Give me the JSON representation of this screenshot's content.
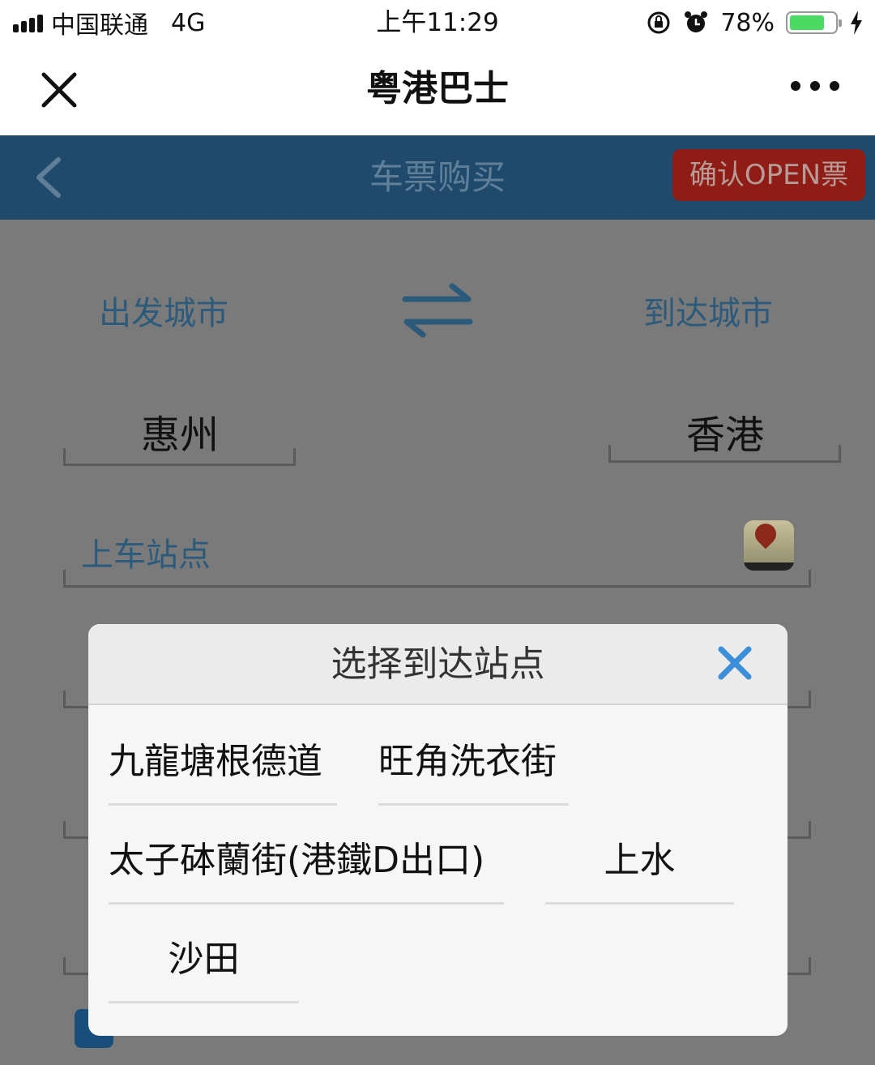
{
  "status_bar": {
    "carrier": "中国联通",
    "network": "4G",
    "time": "上午11:29",
    "battery": "78%",
    "battery_level": 0.78
  },
  "nav": {
    "title": "粤港巴士"
  },
  "page": {
    "title": "车票购买",
    "open_ticket_button": "确认OPEN票",
    "departure_city_label": "出发城市",
    "arrival_city_label": "到达城市",
    "departure_city": "惠州",
    "arrival_city": "香港",
    "boarding_station_label": "上车站点"
  },
  "modal": {
    "title": "选择到达站点",
    "stations": [
      "九龍塘根德道",
      "旺角洗衣街",
      "太子砵蘭街(港鐵D出口)",
      "上水",
      "沙田"
    ]
  },
  "colors": {
    "header_bg": "#1f4a6b",
    "accent_red": "#8f1d15",
    "close_blue": "#3a8fd8",
    "overlay_bg": "#7a7a7a"
  }
}
